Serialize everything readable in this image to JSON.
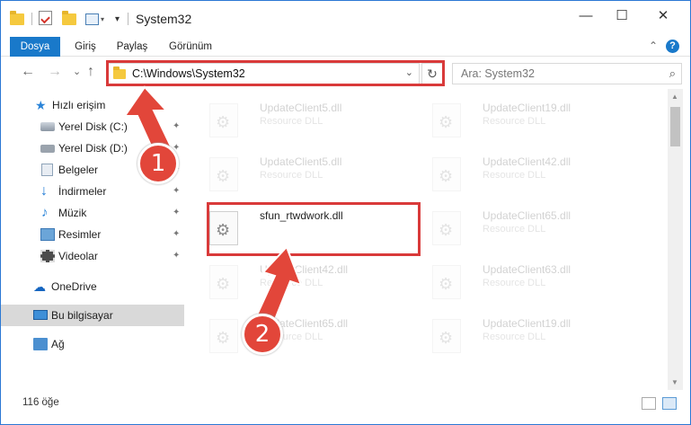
{
  "window": {
    "title": "System32",
    "minimize": "—",
    "maximize": "☐",
    "close": "✕"
  },
  "ribbon": {
    "tabs": [
      "Dosya",
      "Giriş",
      "Paylaş",
      "Görünüm"
    ],
    "collapse_glyph": "⌃",
    "help_glyph": "?"
  },
  "nav": {
    "back": "←",
    "forward": "→",
    "recent": "⌄",
    "up": "↑",
    "address": "C:\\Windows\\System32",
    "address_dropdown": "⌄",
    "refresh": "↻",
    "search_placeholder": "Ara: System32",
    "search_icon": "search-icon"
  },
  "sidebar": {
    "items": [
      {
        "label": "Hızlı erişim",
        "icon": "star-icon"
      },
      {
        "label": "Yerel Disk (C:)",
        "icon": "drive-icon",
        "pinned": true
      },
      {
        "label": "Yerel Disk (D:)",
        "icon": "drive-icon",
        "pinned": true
      },
      {
        "label": "Belgeler",
        "icon": "document-icon",
        "pinned": true
      },
      {
        "label": "İndirmeler",
        "icon": "download-icon",
        "pinned": true
      },
      {
        "label": "Müzik",
        "icon": "music-icon",
        "pinned": true
      },
      {
        "label": "Resimler",
        "icon": "pictures-icon",
        "pinned": true
      },
      {
        "label": "Videolar",
        "icon": "video-icon",
        "pinned": true
      },
      {
        "label": "OneDrive",
        "icon": "cloud-icon"
      },
      {
        "label": "Bu bilgisayar",
        "icon": "computer-icon",
        "selected": true
      },
      {
        "label": "Ağ",
        "icon": "network-icon"
      }
    ],
    "pin_glyph": "📌"
  },
  "files": {
    "left": [
      {
        "name": "UpdateClient5.dll",
        "type": "Resource DLL"
      },
      {
        "name": "UpdateClient5.dll",
        "type": "Resource DLL"
      },
      {
        "name": "sfun_rtwdwork.dll",
        "type": ""
      },
      {
        "name": "UpdateClient42.dll",
        "type": "Resource DLL"
      },
      {
        "name": "UpdateClient65.dll",
        "type": "Resource DLL"
      }
    ],
    "right": [
      {
        "name": "UpdateClient19.dll",
        "type": "Resource DLL"
      },
      {
        "name": "UpdateClient42.dll",
        "type": "Resource DLL"
      },
      {
        "name": "UpdateClient65.dll",
        "type": "Resource DLL"
      },
      {
        "name": "UpdateClient63.dll",
        "type": "Resource DLL"
      },
      {
        "name": "UpdateClient19.dll",
        "type": "Resource DLL"
      }
    ]
  },
  "status": {
    "count": "116 öğe"
  },
  "callouts": [
    "1",
    "2"
  ],
  "colors": {
    "accent": "#1979ca",
    "highlight": "#d93a3a",
    "callout": "#e2463a"
  }
}
